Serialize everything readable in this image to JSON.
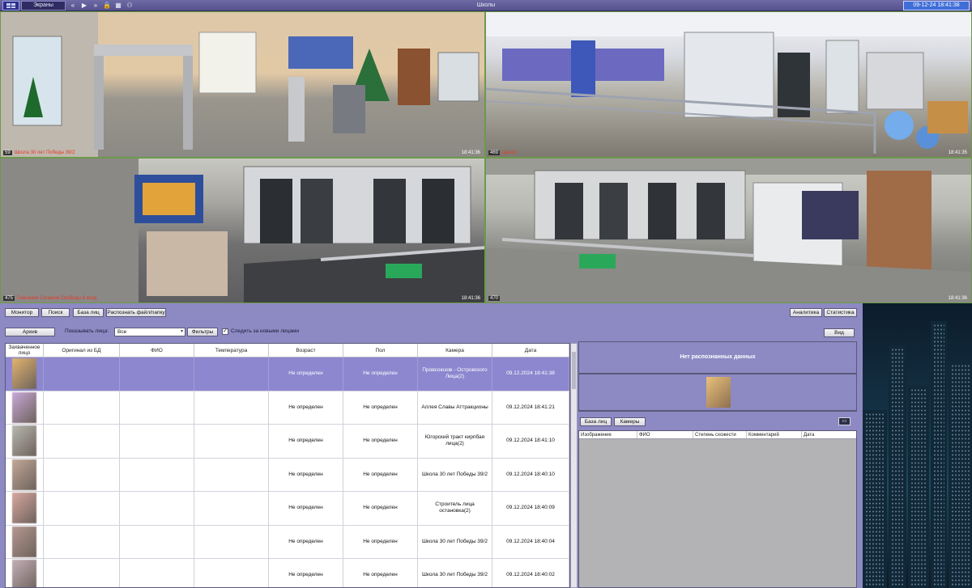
{
  "topbar": {
    "screens_label": "Экраны",
    "title": "Школы",
    "datetime": "09-12-24 18:41:38",
    "icons": [
      "grid-icon",
      "rewind-icon",
      "play-icon",
      "forward-icon",
      "lock-icon",
      "layout-icon",
      "network-icon"
    ]
  },
  "cameras": [
    {
      "id": "59",
      "name": "Школа 30 лет Победы 39/2",
      "time": "18:41:36"
    },
    {
      "id": "469",
      "name": "Центр",
      "time": "18:41:35"
    },
    {
      "id": "475",
      "name": "Гимназия Селанов Свободы 8 вход",
      "time": "18:41:36"
    },
    {
      "id": "470",
      "name": "",
      "time": "18:41:36"
    }
  ],
  "toolbar": {
    "monitor": "Монитор",
    "search": "Поиск",
    "face_db": "База лиц",
    "recognize": "Распознать файл/папку",
    "analytics": "Аналитика",
    "statistics": "Статистика"
  },
  "filters": {
    "archive": "Архив",
    "show_faces_label": "Показывать лица:",
    "show_faces_value": "Все",
    "filters_btn": "Фильтры",
    "follow_new_label": "Следить за новыми лицами",
    "follow_new_checked": true,
    "view_btn": "Вид"
  },
  "table": {
    "columns": [
      "Захваченное лицо",
      "Оригинал из БД",
      "ФИО",
      "Температура",
      "Возраст",
      "Пол",
      "Камера",
      "Дата"
    ],
    "rows": [
      {
        "age": "Не определен",
        "sex": "Не определен",
        "camera": "Провсоюзов - Островского Лица(2)",
        "date": "09.12.2024 18:41:38"
      },
      {
        "age": "Не определен",
        "sex": "Не определен",
        "camera": "Аллея Славы Аттракционы",
        "date": "09.12.2024 18:41:21"
      },
      {
        "age": "Не определен",
        "sex": "Не определен",
        "camera": "Югорский тракт кирпбая лица(2)",
        "date": "09.12.2024 18:41:10"
      },
      {
        "age": "Не определен",
        "sex": "Не определен",
        "camera": "Школа 30 лет Победы 39/2",
        "date": "09.12.2024 18:40:10"
      },
      {
        "age": "Не определен",
        "sex": "Не определен",
        "camera": "Строитель лица остановка(2)",
        "date": "09.12.2024 18:40:09"
      },
      {
        "age": "Не определен",
        "sex": "Не определен",
        "camera": "Школа 30 лет Победы 39/2",
        "date": "09.12.2024 18:40:04"
      },
      {
        "age": "Не определен",
        "sex": "Не определен",
        "camera": "Школа 30 лет Победы 39/2",
        "date": "09.12.2024 18:40:02"
      }
    ]
  },
  "right_panel": {
    "no_data": "Нет распознанных данных",
    "tab_face_db": "База лиц",
    "tab_cameras": "Камеры",
    "columns": [
      "Изображение",
      "ФИО",
      "Степень схожести",
      "Комментарий",
      "Дата"
    ]
  }
}
